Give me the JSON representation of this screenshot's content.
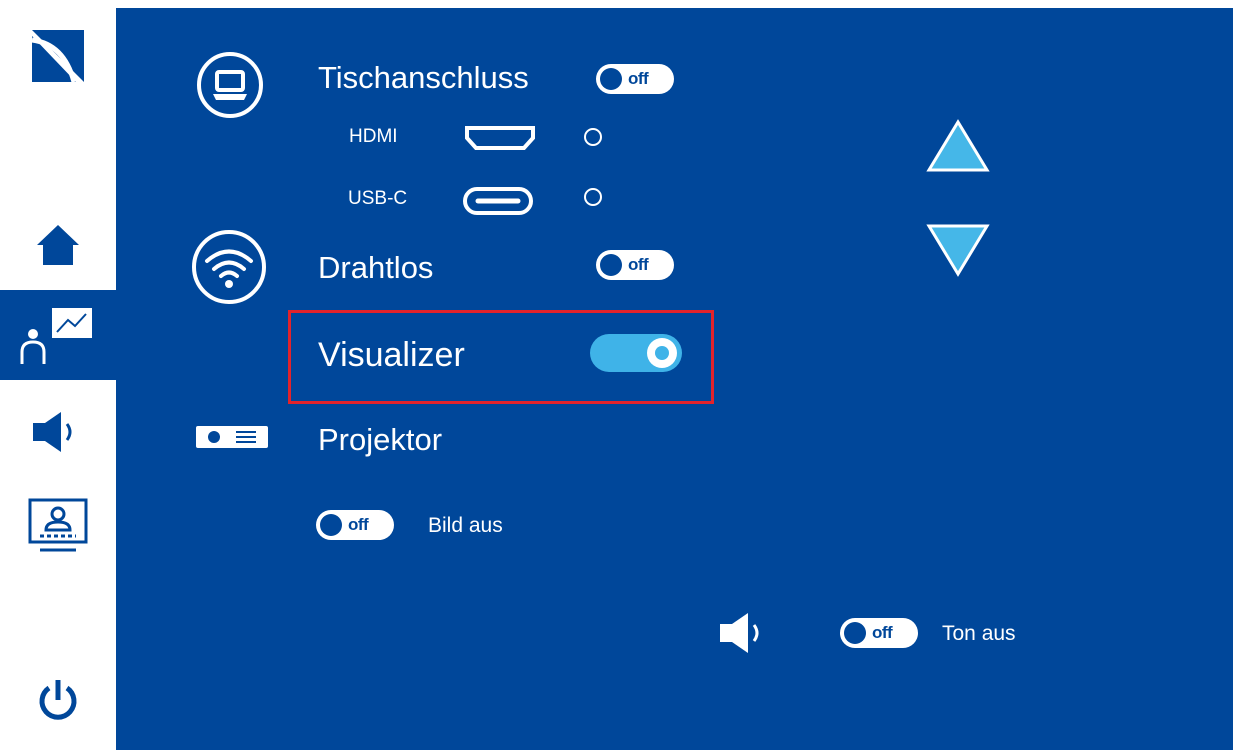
{
  "colors": {
    "background": "#00479a",
    "accent": "#3fb3e8",
    "highlight": "#e3232b",
    "text": "#ffffff"
  },
  "sidebar": {
    "items": [
      {
        "name": "logo",
        "icon": "cast-logo-icon"
      },
      {
        "name": "home",
        "icon": "home-icon"
      },
      {
        "name": "presenter",
        "icon": "presenter-chart-icon",
        "active": true
      },
      {
        "name": "audio",
        "icon": "speaker-icon"
      },
      {
        "name": "display",
        "icon": "screen-user-icon"
      },
      {
        "name": "power",
        "icon": "power-icon"
      }
    ]
  },
  "sources": {
    "table": {
      "label": "Tischanschluss",
      "toggle": "off",
      "inputs": [
        {
          "label": "HDMI",
          "icon": "hdmi-port-icon",
          "selected": false
        },
        {
          "label": "USB-C",
          "icon": "usb-c-port-icon",
          "selected": false
        }
      ]
    },
    "wireless": {
      "label": "Drahtlos",
      "toggle": "off"
    },
    "visualizer": {
      "label": "Visualizer",
      "state": "on"
    },
    "projector": {
      "label": "Projektor",
      "picture_off": {
        "toggle": "off",
        "label": "Bild aus"
      },
      "sound_off": {
        "toggle": "off",
        "label": "Ton aus"
      }
    }
  },
  "scroll": {
    "up": "arrow-up-icon",
    "down": "arrow-down-icon"
  }
}
